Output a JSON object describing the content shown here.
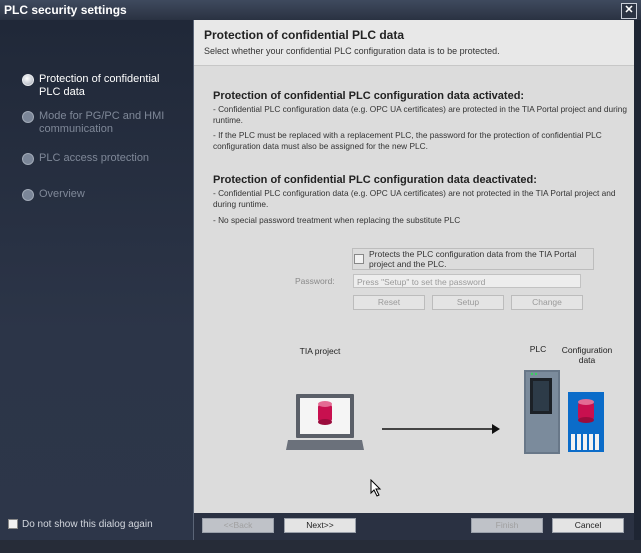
{
  "window": {
    "title": "PLC security settings",
    "close": "✕"
  },
  "sidebar": {
    "items": [
      {
        "label": "Protection of confidential PLC data",
        "active": true
      },
      {
        "label": "Mode for PG/PC and HMI communication",
        "active": false
      },
      {
        "label": "PLC access protection",
        "active": false
      },
      {
        "label": "Overview",
        "active": false
      }
    ],
    "dont_show": "Do not show this dialog again"
  },
  "header": {
    "title": "Protection of confidential PLC data",
    "subtitle": "Select whether your confidential PLC configuration data is to be protected."
  },
  "activated": {
    "title": "Protection of confidential PLC configuration data activated:",
    "p1": "- Confidential PLC configuration data (e.g. OPC UA certificates) are protected in the TIA Portal project and during runtime.",
    "p2": "- If the PLC must be replaced with a replacement PLC, the password for the protection of confidential PLC configuration data must also be assigned for the new PLC."
  },
  "deactivated": {
    "title": "Protection of confidential PLC configuration data deactivated:",
    "p1": "- Confidential PLC configuration data (e.g. OPC UA certificates) are not protected in the TIA Portal project and during runtime.",
    "p2": "- No special password treatment when replacing the substitute PLC"
  },
  "protect_checkbox": {
    "label": "Protects the PLC configuration data from the TIA Portal project and the PLC.",
    "checked": false
  },
  "password": {
    "label": "Password:",
    "placeholder": "Press \"Setup\" to set the password"
  },
  "buttons": {
    "reset": "Reset",
    "setup": "Setup",
    "change": "Change"
  },
  "diagram": {
    "tia_project": "TIA project",
    "plc": "PLC",
    "config_data": "Configuration data"
  },
  "footer": {
    "back": "<<Back",
    "next": "Next>>",
    "finish": "Finish",
    "cancel": "Cancel"
  },
  "colors": {
    "accent": "#c8104f",
    "sidebar": "#2c3548",
    "content": "#dcdcdc"
  }
}
